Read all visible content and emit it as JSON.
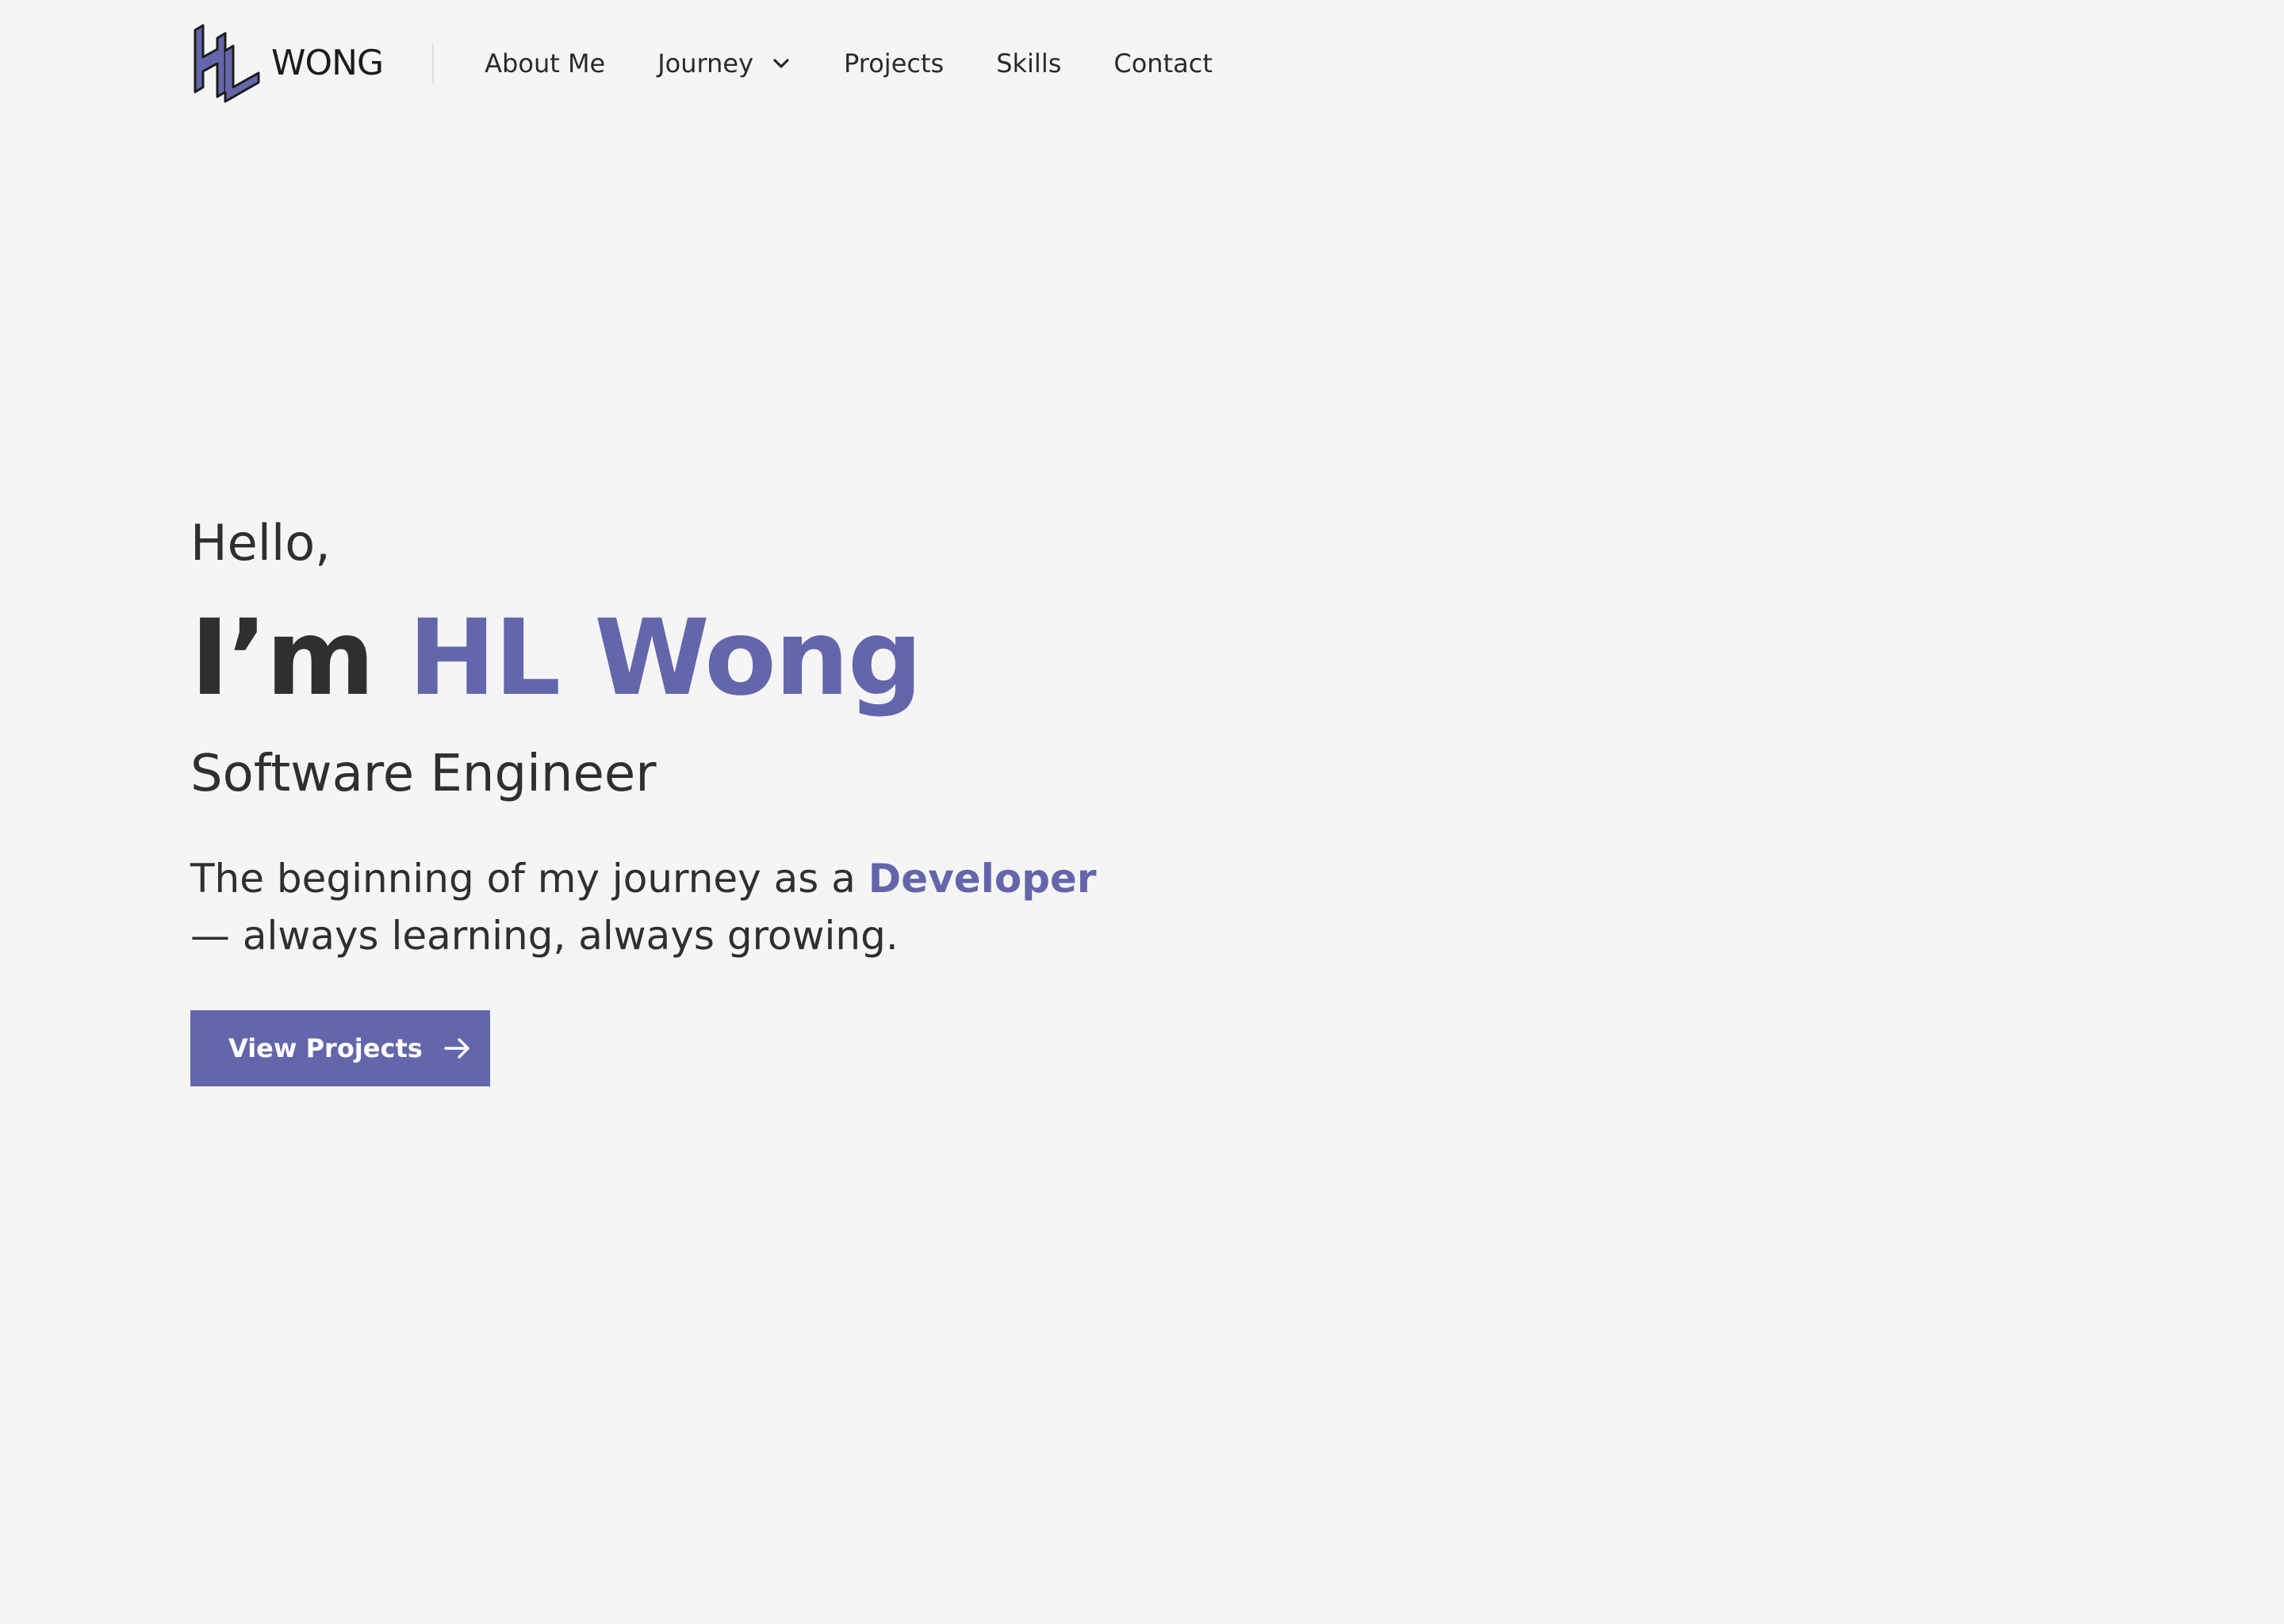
{
  "brand": {
    "name": "WONG",
    "logo_icon": "hl-logo-icon",
    "accent_color": "#6466ac"
  },
  "nav": {
    "items": [
      {
        "label": "About Me"
      },
      {
        "label": "Journey",
        "icon": "chevron-down-icon"
      },
      {
        "label": "Projects"
      },
      {
        "label": "Skills"
      },
      {
        "label": "Contact"
      }
    ]
  },
  "hero": {
    "greeting": "Hello,",
    "intro_prefix": "I’m ",
    "name": "HL Wong",
    "role": "Software Engineer",
    "tagline_before": "The beginning of my journey as a ",
    "tagline_highlight": "Developer",
    "tagline_after": " — always learning, always growing.",
    "cta_label": "View Projects",
    "cta_icon": "arrow-right-icon"
  },
  "colors": {
    "background": "#f5f5f6",
    "text": "#2f2f2f",
    "accent": "#6466ac"
  }
}
